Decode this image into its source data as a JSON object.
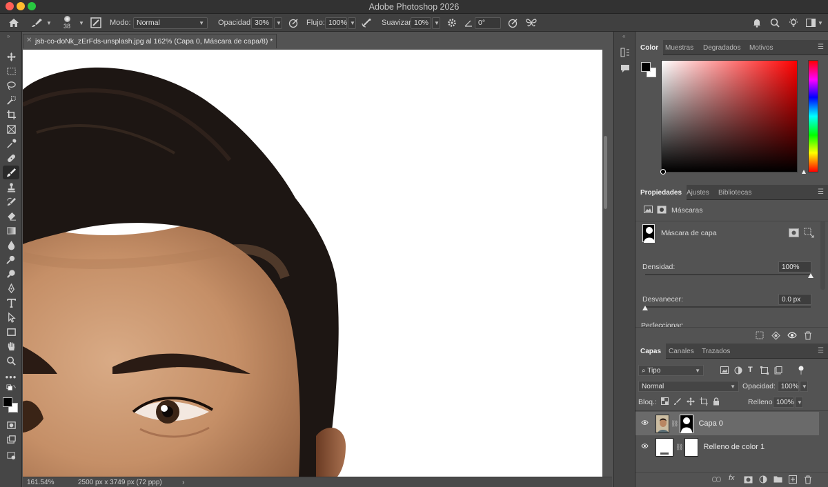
{
  "window": {
    "app_title": "Adobe Photoshop 2026"
  },
  "options_bar": {
    "brush_size": "38",
    "mode_label": "Modo:",
    "mode_value": "Normal",
    "opacity_label": "Opacidad:",
    "opacity_value": "30%",
    "flow_label": "Flujo:",
    "flow_value": "100%",
    "smoothing_label": "Suavizar:",
    "smoothing_value": "10%",
    "angle_value": "0°"
  },
  "document": {
    "tab_title": "jsb-co-doNk_zErFds-unsplash.jpg al 162% (Capa 0, Máscara de capa/8) *"
  },
  "status_bar": {
    "zoom": "161.54%",
    "doc_info": "2500 px x 3749 px (72 ppp)",
    "arrow": "›"
  },
  "color_panel": {
    "tabs": [
      "Color",
      "Muestras",
      "Degradados",
      "Motivos"
    ],
    "active_tab": "Color",
    "picker_hue": "#ff0000",
    "foreground": "#000000",
    "background": "#ffffff"
  },
  "properties_panel": {
    "tabs": [
      "Propiedades",
      "Ajustes",
      "Bibliotecas"
    ],
    "section_label": "Máscaras",
    "mask_label": "Máscara de capa",
    "density_label": "Densidad:",
    "density_value": "100%",
    "density_level": 1.0,
    "feather_label": "Desvanecer:",
    "feather_value": "0.0 px",
    "feather_level": 0.0,
    "cut_label": "Perfeccionar:"
  },
  "layers_panel": {
    "tabs": [
      "Capas",
      "Canales",
      "Trazados"
    ],
    "filter_value": "Tipo",
    "blend_mode": "Normal",
    "opacity_label": "Opacidad:",
    "opacity_value": "100%",
    "lock_label": "Bloq.:",
    "fill_label": "Relleno:",
    "fill_value": "100%",
    "layers": [
      {
        "name": "Capa 0",
        "selected": true
      },
      {
        "name": "Relleno de color 1",
        "selected": false
      }
    ]
  }
}
